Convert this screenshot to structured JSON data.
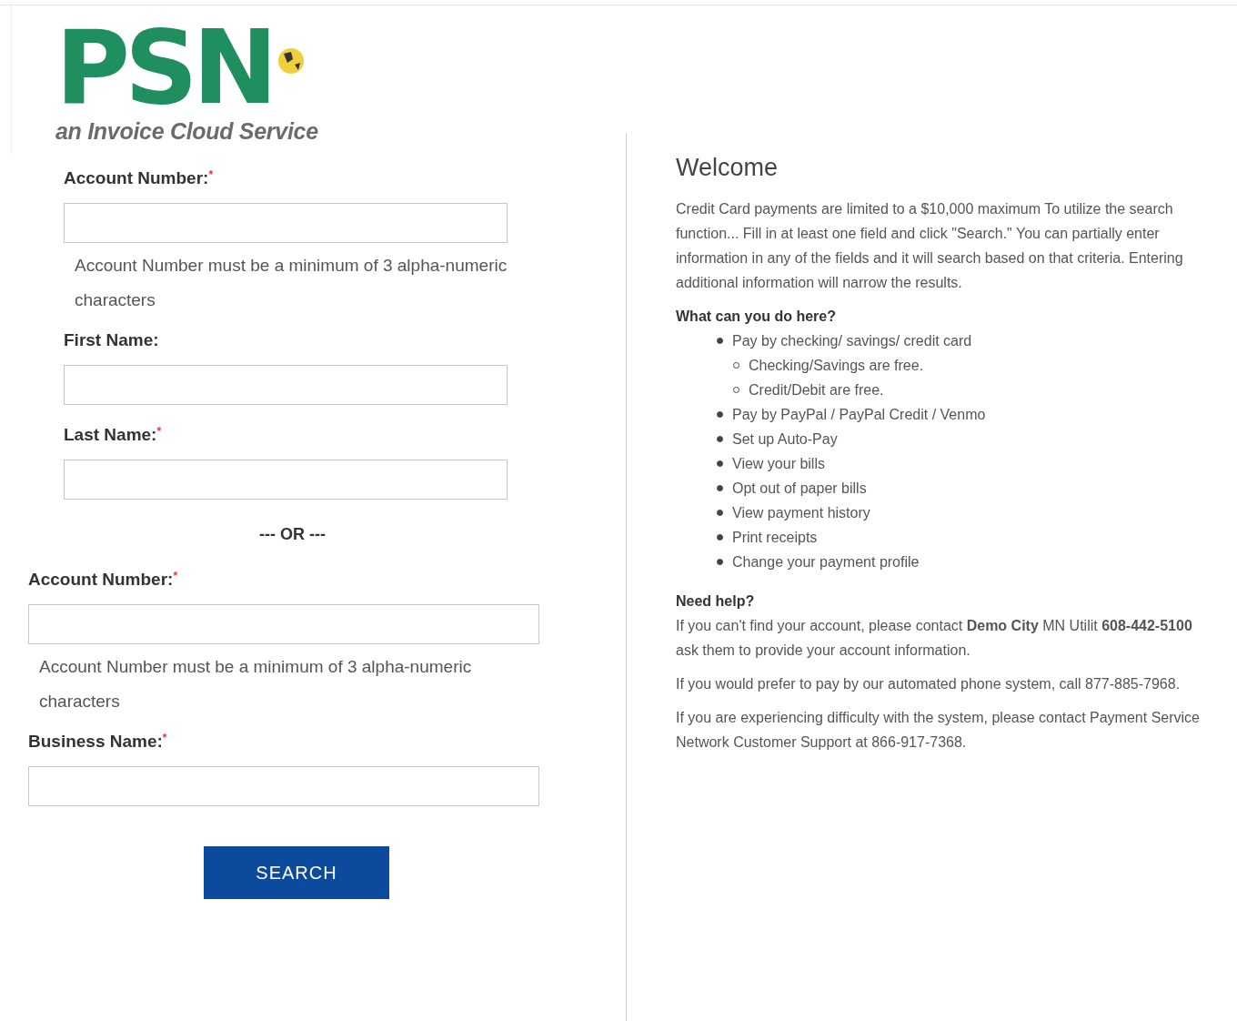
{
  "logo": {
    "mark": "PSN",
    "tagline": "an Invoice Cloud Service"
  },
  "form": {
    "groups": [
      {
        "fields": [
          {
            "label": "Account Number:",
            "required": true,
            "hint": "Account Number must be a minimum of 3 alpha-numeric characters"
          },
          {
            "label": "First Name:",
            "required": false
          },
          {
            "label": "Last Name:",
            "required": true
          }
        ]
      },
      {
        "fields": [
          {
            "label": "Account Number:",
            "required": true,
            "hint": "Account Number must be a minimum of 3 alpha-numeric characters"
          },
          {
            "label": "Business Name:",
            "required": true
          }
        ]
      }
    ],
    "required_mark": "*",
    "separator": "--- OR ---",
    "button": "SEARCH"
  },
  "welcome": {
    "title": "Welcome",
    "intro": "Credit Card payments are limited to a $10,000 maximum To utilize the search function... Fill in at least one field and click \"Search.\" You can partially enter information in any of the fields and it will search based on that criteria. Entering additional information will narrow the results.",
    "what_heading": "What can you do here?",
    "items": [
      {
        "text": "Pay by checking/ savings/ credit card",
        "children": [
          {
            "text": "Checking/Savings are free."
          },
          {
            "text": "Credit/Debit are free."
          }
        ]
      },
      {
        "text": "Pay by PayPal / PayPal Credit / Venmo"
      },
      {
        "text": "Set up Auto-Pay"
      },
      {
        "text": "View your bills"
      },
      {
        "text": "Opt out of paper bills"
      },
      {
        "text": "View payment history"
      },
      {
        "text": "Print receipts"
      },
      {
        "text": "Change your payment profile"
      }
    ],
    "help_heading": "Need help?",
    "help": [
      "If you can't find your account, please contact **Demo City** MN Utilit **608-442-5100** ask them to provide your account information.",
      "If you would prefer to pay by our automated phone system, call 877-885-7968.",
      "If you are experiencing difficulty with the system, please contact Payment Service Network Customer Support at 866-917-7368."
    ]
  }
}
